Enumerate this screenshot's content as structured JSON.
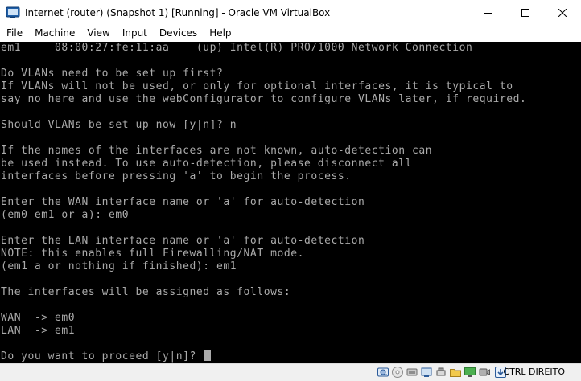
{
  "window": {
    "title": "Internet (router) (Snapshot 1) [Running] - Oracle VM VirtualBox"
  },
  "menu": {
    "items": [
      "File",
      "Machine",
      "View",
      "Input",
      "Devices",
      "Help"
    ]
  },
  "console": {
    "lines": [
      "em1     08:00:27:fe:11:aa    (up) Intel(R) PRO/1000 Network Connection",
      "",
      "Do VLANs need to be set up first?",
      "If VLANs will not be used, or only for optional interfaces, it is typical to",
      "say no here and use the webConfigurator to configure VLANs later, if required.",
      "",
      "Should VLANs be set up now [y|n]? n",
      "",
      "If the names of the interfaces are not known, auto-detection can",
      "be used instead. To use auto-detection, please disconnect all",
      "interfaces before pressing 'a' to begin the process.",
      "",
      "Enter the WAN interface name or 'a' for auto-detection",
      "(em0 em1 or a): em0",
      "",
      "Enter the LAN interface name or 'a' for auto-detection",
      "NOTE: this enables full Firewalling/NAT mode.",
      "(em1 a or nothing if finished): em1",
      "",
      "The interfaces will be assigned as follows:",
      "",
      "WAN  -> em0",
      "LAN  -> em1",
      "",
      "Do you want to proceed [y|n]? "
    ]
  },
  "statusbar": {
    "icons": [
      "hard-disk-icon",
      "optical-drive-icon",
      "audio-icon",
      "network-icon",
      "usb-icon",
      "shared-folder-icon",
      "display-icon",
      "recording-icon",
      "mouse-integration-icon"
    ],
    "host_key": "CTRL DIREITO"
  },
  "colors": {
    "console_bg": "#000000",
    "console_fg": "#aaaaaa",
    "statusbar_bg": "#f0f0f0"
  }
}
